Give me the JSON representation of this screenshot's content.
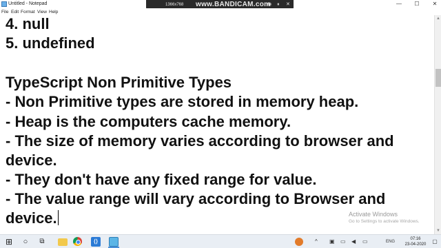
{
  "window": {
    "title": "Untitled - Notepad",
    "minimize_glyph": "—",
    "maximize_glyph": "☐",
    "close_glyph": "✕"
  },
  "bandicam": {
    "resolution": "1366x768",
    "brand": "www.BANDICAM.com",
    "camera_glyph": "◉",
    "pause_glyph": "⏸",
    "close_glyph": "✕"
  },
  "menu": [
    "File",
    "Edit",
    "Format",
    "View",
    "Help"
  ],
  "editor": {
    "lines": [
      "4. null",
      "5. undefined",
      "",
      "TypeScript Non Primitive Types",
      "- Non Primitive types are stored in memory heap.",
      "- Heap is the computers cache memory.",
      "- The size of memory varies according to browser and",
      "device.",
      "- They don't have any fixed range for value.",
      "- The value range will vary according to Browser and",
      "device."
    ]
  },
  "watermark": {
    "title": "Activate Windows",
    "subtitle": "Go to Settings to activate Windows."
  },
  "taskbar": {
    "start_glyph": "⊞",
    "search_glyph": "○",
    "taskview_glyph": "⧉",
    "tray_up_glyph": "^",
    "volume_glyph": "🔊",
    "network_glyph": "▭",
    "language": "ENG",
    "time": "07:16",
    "date": "23-04-2020",
    "notification_glyph": "▢"
  }
}
